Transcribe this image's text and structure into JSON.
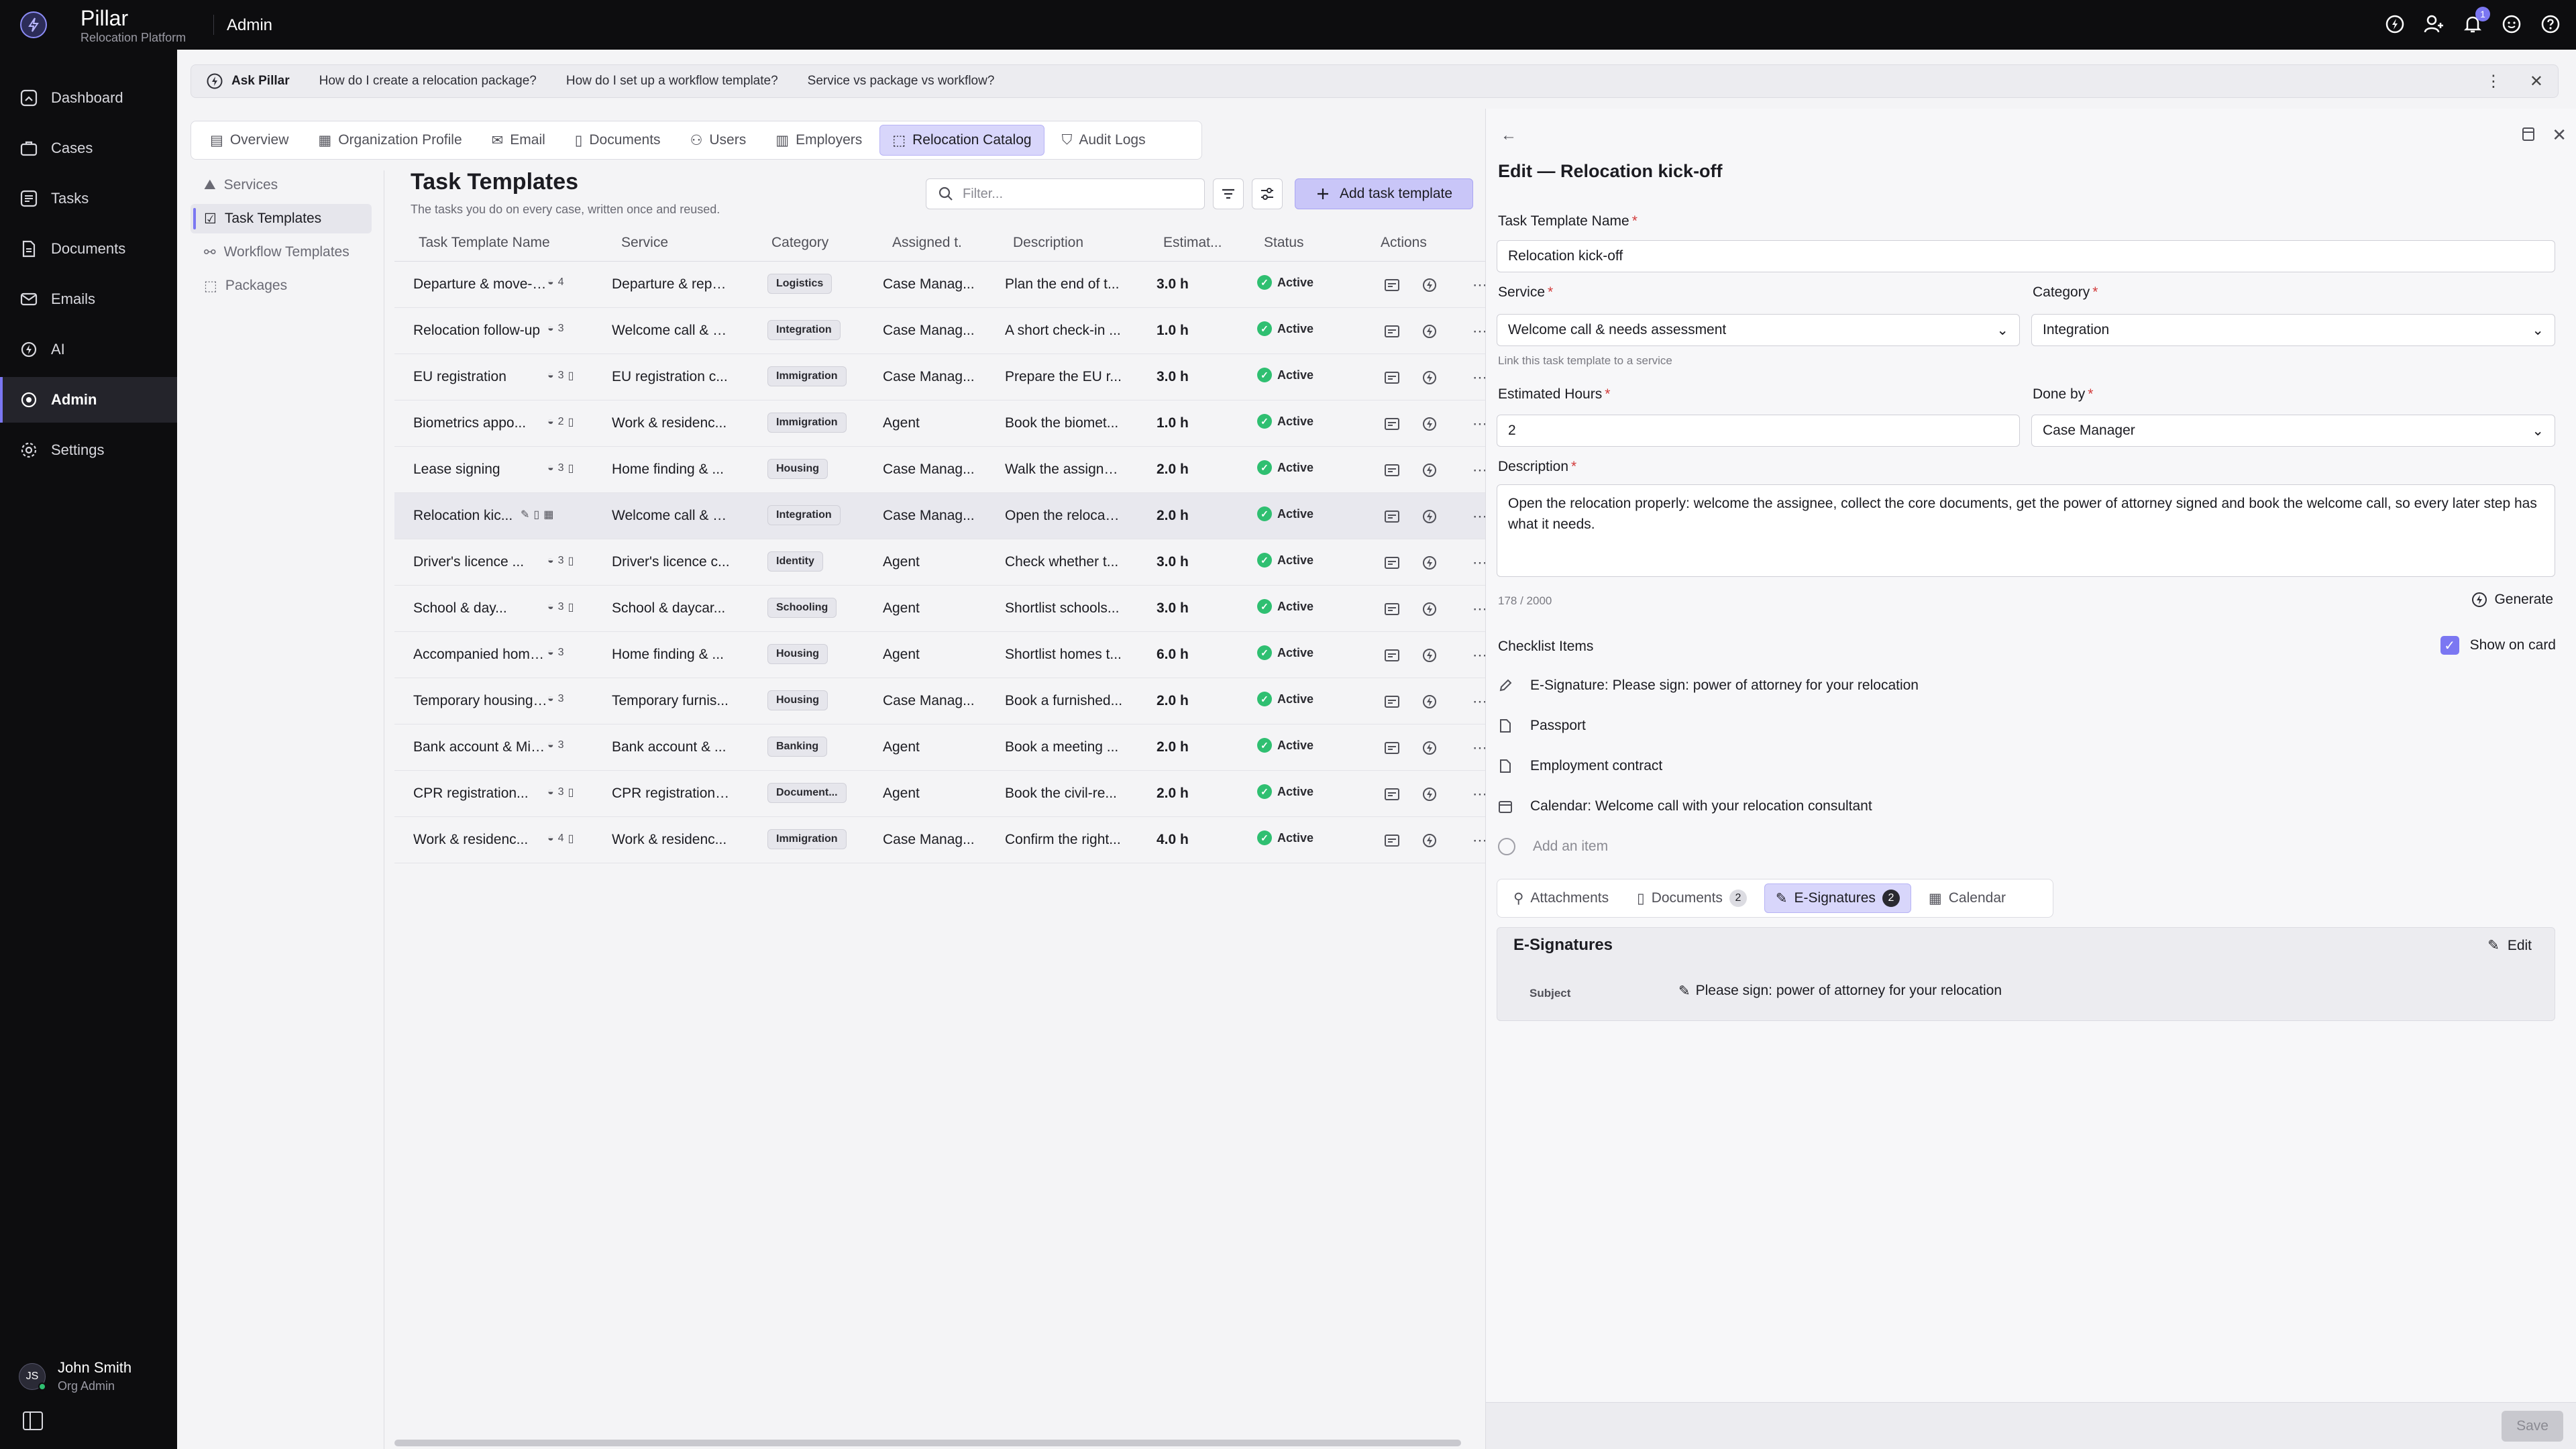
{
  "app": {
    "name": "Pillar",
    "subtitle": "Relocation Platform",
    "section": "Admin",
    "notification_count": "1"
  },
  "sidebar": {
    "items": [
      {
        "label": "Dashboard",
        "icon": "dashboard-icon"
      },
      {
        "label": "Cases",
        "icon": "briefcase-icon"
      },
      {
        "label": "Tasks",
        "icon": "tasks-icon"
      },
      {
        "label": "Documents",
        "icon": "document-icon"
      },
      {
        "label": "Emails",
        "icon": "mail-icon"
      },
      {
        "label": "AI",
        "icon": "ai-icon"
      },
      {
        "label": "Admin",
        "icon": "admin-icon"
      },
      {
        "label": "Settings",
        "icon": "gear-icon"
      }
    ],
    "active": "Admin",
    "user": {
      "initials": "JS",
      "name": "John Smith",
      "role": "Org Admin"
    }
  },
  "ask": {
    "title": "Ask Pillar",
    "questions": [
      "How do I create a relocation package?",
      "How do I set up a workflow template?",
      "Service vs package vs workflow?"
    ]
  },
  "tabs": [
    "Overview",
    "Organization Profile",
    "Email",
    "Documents",
    "Users",
    "Employers",
    "Relocation Catalog",
    "Audit Logs"
  ],
  "active_tab": "Relocation Catalog",
  "subnav": [
    "Services",
    "Task Templates",
    "Workflow Templates",
    "Packages"
  ],
  "list": {
    "title": "Task Templates",
    "subtitle": "The tasks you do on every case, written once and reused.",
    "filter_placeholder": "Filter...",
    "add_label": "Add task template",
    "columns": [
      "Task Template Name",
      "Service",
      "Category",
      "Assigned t...",
      "Description",
      "Estimat...",
      "Status",
      "Actions"
    ],
    "rows": [
      {
        "name": "Departure & move-o...",
        "count": "4",
        "service": "Departure & repa...",
        "category": "Logistics",
        "assigned": "Case Manag...",
        "description": "Plan the end of t...",
        "hours": "3.0 h",
        "status": "Active"
      },
      {
        "name": "Relocation follow-up",
        "count": "3",
        "service": "Welcome call & n...",
        "category": "Integration",
        "assigned": "Case Manag...",
        "description": "A short check-in ...",
        "hours": "1.0 h",
        "status": "Active"
      },
      {
        "name": "EU registration",
        "count": "3",
        "service": "EU registration c...",
        "category": "Immigration",
        "assigned": "Case Manag...",
        "description": "Prepare the EU r...",
        "hours": "3.0 h",
        "status": "Active"
      },
      {
        "name": "Biometrics appo...",
        "count": "2",
        "service": "Work & residenc...",
        "category": "Immigration",
        "assigned": "Agent",
        "description": "Book the biomet...",
        "hours": "1.0 h",
        "status": "Active"
      },
      {
        "name": "Lease signing",
        "count": "3",
        "service": "Home finding & ...",
        "category": "Housing",
        "assigned": "Case Manag...",
        "description": "Walk the assigne...",
        "hours": "2.0 h",
        "status": "Active"
      },
      {
        "name": "Relocation kic...",
        "count": "",
        "service": "Welcome call & n...",
        "category": "Integration",
        "assigned": "Case Manag...",
        "description": "Open the relocati...",
        "hours": "2.0 h",
        "status": "Active"
      },
      {
        "name": "Driver's licence ...",
        "count": "3",
        "service": "Driver's licence c...",
        "category": "Identity",
        "assigned": "Agent",
        "description": "Check whether t...",
        "hours": "3.0 h",
        "status": "Active"
      },
      {
        "name": "School & day...",
        "count": "3",
        "service": "School & daycar...",
        "category": "Schooling",
        "assigned": "Agent",
        "description": "Shortlist schools...",
        "hours": "3.0 h",
        "status": "Active"
      },
      {
        "name": "Accompanied home...",
        "count": "3",
        "service": "Home finding & ...",
        "category": "Housing",
        "assigned": "Agent",
        "description": "Shortlist homes t...",
        "hours": "6.0 h",
        "status": "Active"
      },
      {
        "name": "Temporary housing ...",
        "count": "3",
        "service": "Temporary furnis...",
        "category": "Housing",
        "assigned": "Case Manag...",
        "description": "Book a furnished...",
        "hours": "2.0 h",
        "status": "Active"
      },
      {
        "name": "Bank account & MitI...",
        "count": "3",
        "service": "Bank account & ...",
        "category": "Banking",
        "assigned": "Agent",
        "description": "Book a meeting ...",
        "hours": "2.0 h",
        "status": "Active"
      },
      {
        "name": "CPR registration...",
        "count": "3",
        "service": "CPR registration ...",
        "category": "Document...",
        "assigned": "Agent",
        "description": "Book the civil-re...",
        "hours": "2.0 h",
        "status": "Active"
      },
      {
        "name": "Work & residenc...",
        "count": "4",
        "service": "Work & residenc...",
        "category": "Immigration",
        "assigned": "Case Manag...",
        "description": "Confirm the right...",
        "hours": "4.0 h",
        "status": "Active"
      }
    ]
  },
  "panel": {
    "title": "Edit — Relocation kick-off",
    "name_label": "Task Template Name",
    "name_value": "Relocation kick-off",
    "service_label": "Service",
    "service_value": "Welcome call & needs assessment",
    "service_hint": "Link this task template to a service",
    "category_label": "Category",
    "category_value": "Integration",
    "hours_label": "Estimated Hours",
    "hours_value": "2",
    "done_by_label": "Done by",
    "done_by_value": "Case Manager",
    "description_label": "Description",
    "description_value": "Open the relocation properly: welcome the assignee, collect the core documents, get the power of attorney signed and book the welcome call, so every later step has what it needs.",
    "char_count": "178 / 2000",
    "generate_label": "Generate",
    "checklist_label": "Checklist Items",
    "show_on_card_label": "Show on card",
    "checklist": [
      {
        "icon": "pen-icon",
        "text": "E-Signature: Please sign: power of attorney for your relocation"
      },
      {
        "icon": "document-icon",
        "text": "Passport"
      },
      {
        "icon": "document-icon",
        "text": "Employment contract"
      },
      {
        "icon": "calendar-icon",
        "text": "Calendar: Welcome call with your relocation consultant"
      }
    ],
    "add_item_placeholder": "Add an item",
    "sub_tabs": [
      {
        "label": "Attachments",
        "count": ""
      },
      {
        "label": "Documents",
        "count": "2"
      },
      {
        "label": "E-Signatures",
        "count": "2"
      },
      {
        "label": "Calendar",
        "count": ""
      }
    ],
    "esig": {
      "title": "E-Signatures",
      "edit_label": "Edit",
      "subject_label": "Subject",
      "subject_value": "Please sign: power of attorney for your relocation"
    },
    "save_label": "Save"
  },
  "colors": {
    "accent": "#7b77f2",
    "active_green": "#2fbf71",
    "sidebar_bg": "#0d0d0f"
  }
}
